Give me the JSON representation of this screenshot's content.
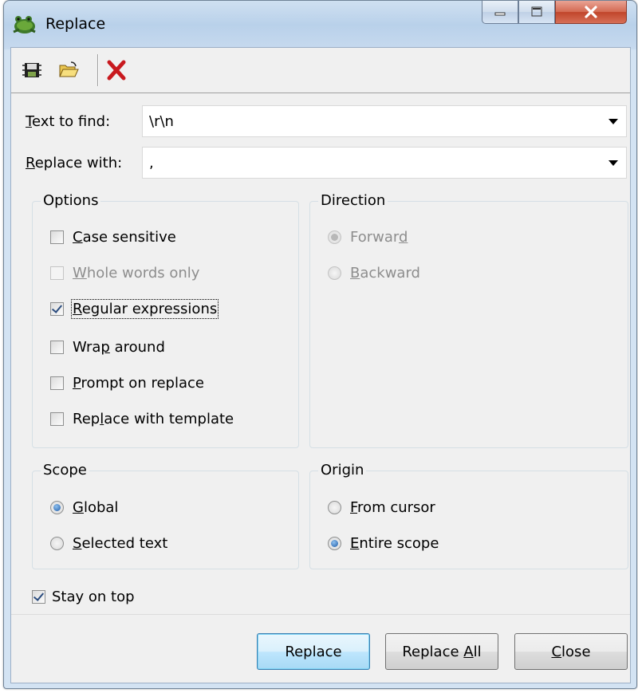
{
  "window": {
    "title": "Replace"
  },
  "toolbar": {
    "icons": [
      "save-settings-icon",
      "open-folder-icon",
      "delete-icon"
    ]
  },
  "find": {
    "label_pre": "",
    "label_u": "T",
    "label_post": "ext to find:",
    "value": "\\r\\n"
  },
  "replace": {
    "label_u": "R",
    "label_post": "eplace with:",
    "value": ","
  },
  "options": {
    "title": "Options",
    "items": [
      {
        "pre": "",
        "u": "C",
        "post": "ase sensitive",
        "checked": false,
        "disabled": false
      },
      {
        "pre": "",
        "u": "W",
        "post": "hole words only",
        "checked": false,
        "disabled": true
      },
      {
        "pre": "",
        "u": "R",
        "post": "egular expressions",
        "checked": true,
        "disabled": false
      },
      {
        "pre": "Wra",
        "u": "p",
        "post": " around",
        "checked": false,
        "disabled": false
      },
      {
        "pre": "",
        "u": "P",
        "post": "rompt on replace",
        "checked": false,
        "disabled": false
      },
      {
        "pre": "Rep",
        "u": "l",
        "post": "ace with template",
        "checked": false,
        "disabled": false
      }
    ]
  },
  "direction": {
    "title": "Direction",
    "items": [
      {
        "pre": "Forwar",
        "u": "d",
        "post": "",
        "checked": true,
        "disabled": true
      },
      {
        "pre": "",
        "u": "B",
        "post": "ackward",
        "checked": false,
        "disabled": true
      }
    ]
  },
  "scope": {
    "title": "Scope",
    "items": [
      {
        "pre": "",
        "u": "G",
        "post": "lobal",
        "checked": true
      },
      {
        "pre": "",
        "u": "S",
        "post": "elected text",
        "checked": false
      }
    ]
  },
  "origin": {
    "title": "Origin",
    "items": [
      {
        "pre": "",
        "u": "F",
        "post": "rom cursor",
        "checked": false
      },
      {
        "pre": "",
        "u": "E",
        "post": "ntire scope",
        "checked": true
      }
    ]
  },
  "stay_on_top": {
    "label": "Stay on top",
    "checked": true
  },
  "buttons": {
    "replace": "Replace",
    "replace_all_pre": "Replace ",
    "replace_all_u": "A",
    "replace_all_post": "ll",
    "close_u": "C",
    "close_post": "lose"
  }
}
